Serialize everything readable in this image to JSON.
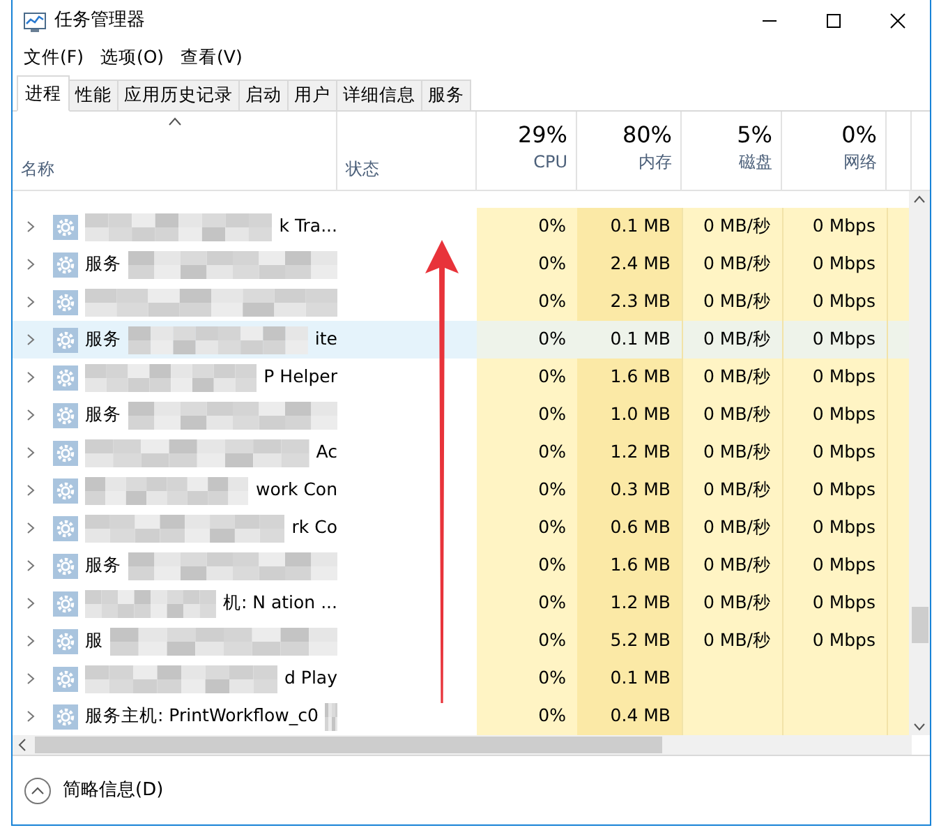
{
  "window": {
    "title": "任务管理器"
  },
  "menu": [
    "文件(F)",
    "选项(O)",
    "查看(V)"
  ],
  "tabs": [
    {
      "label": "进程",
      "selected": true
    },
    {
      "label": "性能",
      "selected": false
    },
    {
      "label": "应用历史记录",
      "selected": false
    },
    {
      "label": "启动",
      "selected": false
    },
    {
      "label": "用户",
      "selected": false
    },
    {
      "label": "详细信息",
      "selected": false
    },
    {
      "label": "服务",
      "selected": false
    }
  ],
  "columns": [
    {
      "kind": "name",
      "label": "名称"
    },
    {
      "kind": "status",
      "label": "状态"
    },
    {
      "kind": "metric",
      "total": "29%",
      "label": "CPU"
    },
    {
      "kind": "metric",
      "total": "80%",
      "label": "内存"
    },
    {
      "kind": "metric",
      "total": "5%",
      "label": "磁盘"
    },
    {
      "kind": "metric",
      "total": "0%",
      "label": "网络"
    }
  ],
  "rows": [
    {
      "name_end": "k Tra...",
      "cpu": "0%",
      "memory": "0.1 MB",
      "disk": "0 MB/秒",
      "network": "0 Mbps",
      "selected": false
    },
    {
      "name_start": "服务",
      "cpu": "0%",
      "memory": "2.4 MB",
      "disk": "0 MB/秒",
      "network": "0 Mbps",
      "selected": false
    },
    {
      "cpu": "0%",
      "memory": "2.3 MB",
      "disk": "0 MB/秒",
      "network": "0 Mbps",
      "selected": false
    },
    {
      "name_start": "服务",
      "name_end": "ite",
      "cpu": "0%",
      "memory": "0.1 MB",
      "disk": "0 MB/秒",
      "network": "0 Mbps",
      "selected": true
    },
    {
      "name_end": "P Helper",
      "cpu": "0%",
      "memory": "1.6 MB",
      "disk": "0 MB/秒",
      "network": "0 Mbps",
      "selected": false
    },
    {
      "name_start": "服务",
      "cpu": "0%",
      "memory": "1.0 MB",
      "disk": "0 MB/秒",
      "network": "0 Mbps",
      "selected": false
    },
    {
      "name_end": "Ac",
      "cpu": "0%",
      "memory": "1.2 MB",
      "disk": "0 MB/秒",
      "network": "0 Mbps",
      "selected": false
    },
    {
      "name_end": "work Con",
      "cpu": "0%",
      "memory": "0.3 MB",
      "disk": "0 MB/秒",
      "network": "0 Mbps",
      "selected": false
    },
    {
      "name_end": "rk Co",
      "cpu": "0%",
      "memory": "0.6 MB",
      "disk": "0 MB/秒",
      "network": "0 Mbps",
      "selected": false
    },
    {
      "name_start": "服务",
      "cpu": "0%",
      "memory": "1.6 MB",
      "disk": "0 MB/秒",
      "network": "0 Mbps",
      "selected": false
    },
    {
      "name_end": "机: N ation ...",
      "cpu": "0%",
      "memory": "1.2 MB",
      "disk": "0 MB/秒",
      "network": "0 Mbps",
      "selected": false
    },
    {
      "name_start": "服",
      "cpu": "0%",
      "memory": "5.2 MB",
      "disk": "0 MB/秒",
      "network": "0 Mbps",
      "selected": false
    },
    {
      "name_end": "d Play",
      "cpu": "0%",
      "memory": "0.1 MB",
      "selected": false
    },
    {
      "name_start": "服务主机: PrintWorkflow_c0",
      "cpu": "0%",
      "memory": "0.4 MB",
      "selected": false
    }
  ],
  "footer": {
    "label": "简略信息(D)"
  }
}
